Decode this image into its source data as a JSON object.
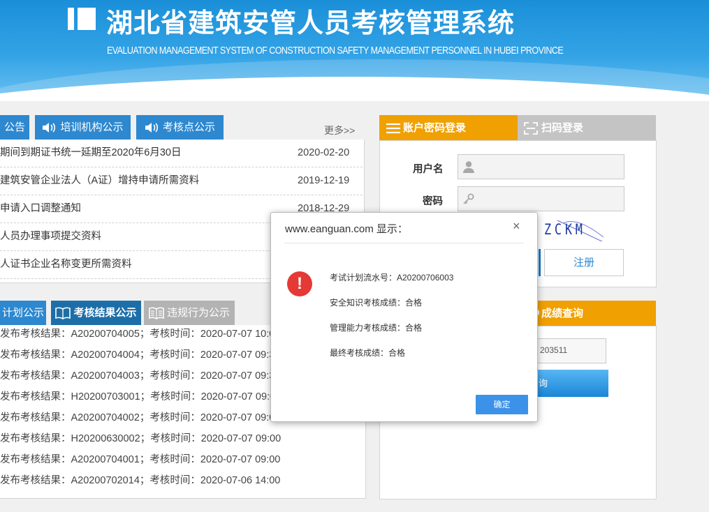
{
  "header": {
    "title": "湖北省建筑安管人员考核管理系统",
    "subtitle": "EVALUATION MANAGEMENT SYSTEM OF CONSTRUCTION SAFETY MANAGEMENT PERSONNEL IN HUBEI PROVINCE"
  },
  "notice": {
    "tabs": [
      "公告",
      "培训机构公示",
      "考核点公示"
    ],
    "more": "更多>>",
    "items": [
      {
        "text": "期间到期证书统一延期至2020年6月30日",
        "date": "2020-02-20"
      },
      {
        "text": "建筑安管企业法人（A证）增持申请所需资料",
        "date": "2019-12-19"
      },
      {
        "text": "申请入口调整通知",
        "date": "2018-12-29"
      },
      {
        "text": "人员办理事项提交资料",
        "date": ""
      },
      {
        "text": "人证书企业名称变更所需资料",
        "date": ""
      }
    ]
  },
  "results": {
    "tabs": [
      "计划公示",
      "考核结果公示",
      "违规行为公示"
    ],
    "items": [
      "发布考核结果：A20200704005；考核时间：2020-07-07 10:00",
      "发布考核结果：A20200704004；考核时间：2020-07-07 09:30",
      "发布考核结果：A20200704003；考核时间：2020-07-07 09:30",
      "发布考核结果：H20200703001；考核时间：2020-07-07 09:00",
      "发布考核结果：A20200704002；考核时间：2020-07-07 09:00",
      "发布考核结果：H20200630002；考核时间：2020-07-07 09:00",
      "发布考核结果：A20200704001；考核时间：2020-07-07 09:00",
      "发布考核结果：A20200702014；考核时间：2020-07-06 14:00"
    ]
  },
  "login": {
    "tab_password": "账户密码登录",
    "tab_scan": "扫码登录",
    "username_label": "用户名",
    "password_label": "密码",
    "captcha_text": "ZCKM",
    "register_label": "注册"
  },
  "score": {
    "header": "成绩查询",
    "input_value": "203511",
    "button_label": "询"
  },
  "dialog": {
    "title": "www.eanguan.com 显示：",
    "close": "×",
    "lines": [
      "考试计划流水号：A20200706003",
      "安全知识考核成绩：合格",
      "管理能力考核成绩：合格",
      "最终考核成绩：合格"
    ],
    "ok_label": "确定"
  },
  "colors": {
    "header_blue": "#1a8fd8",
    "tab_blue": "#2d88d0",
    "tab_dark_blue": "#1d6ea8",
    "orange": "#f0a000",
    "gray_tab": "#b3b3b3",
    "error_red": "#e53935",
    "ok_button": "#3c92e8"
  }
}
